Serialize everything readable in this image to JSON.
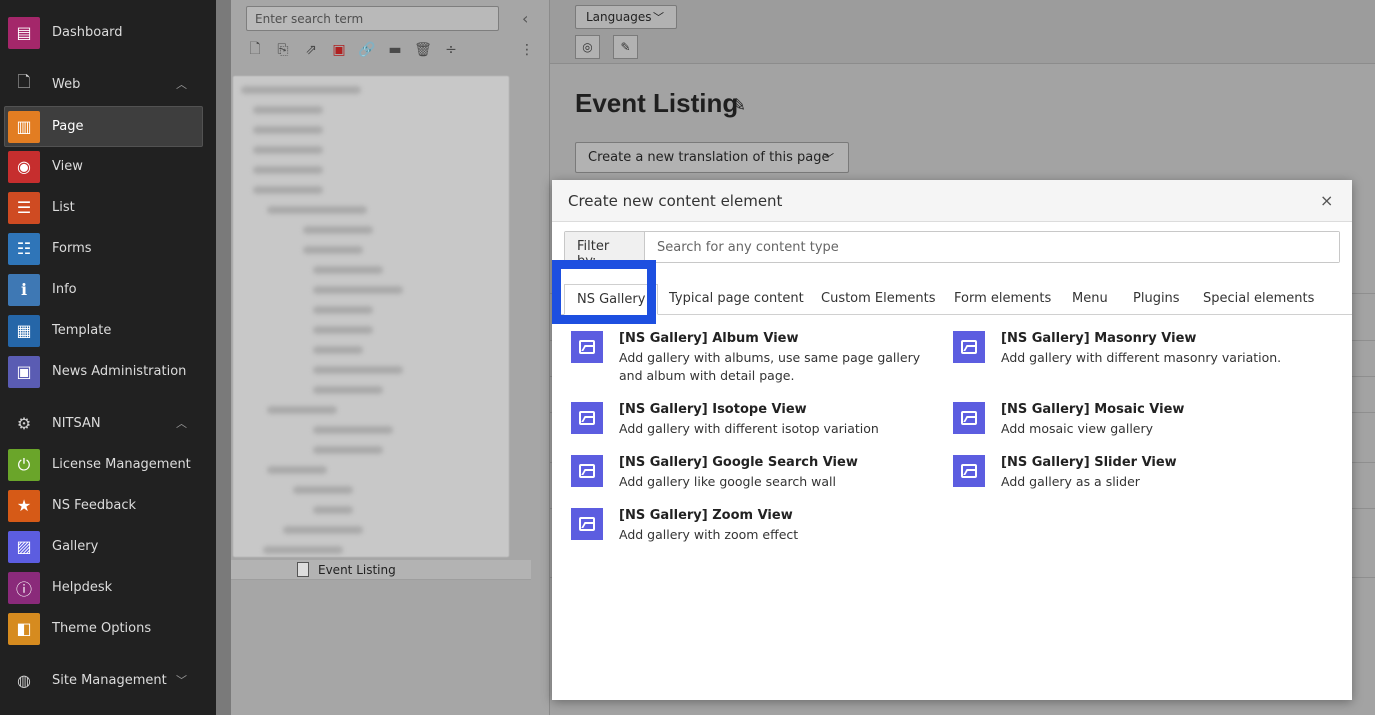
{
  "module_menu": {
    "items": [
      {
        "label": "Dashboard",
        "icon": "dashboard-icon",
        "color": "#a4276a"
      },
      {
        "label": "Web",
        "icon": "web-page-icon",
        "group": true
      },
      {
        "label": "Page",
        "icon": "page-module-icon",
        "color": "#e27d22",
        "active": true
      },
      {
        "label": "View",
        "icon": "eye-icon",
        "color": "#c62e2e"
      },
      {
        "label": "List",
        "icon": "list-icon",
        "color": "#cf4b22"
      },
      {
        "label": "Forms",
        "icon": "forms-icon",
        "color": "#2f75b8"
      },
      {
        "label": "Info",
        "icon": "info-icon",
        "color": "#3e78b4"
      },
      {
        "label": "Template",
        "icon": "template-icon",
        "color": "#2566a8"
      },
      {
        "label": "News Administration",
        "icon": "news-icon",
        "color": "#5a5cb3"
      },
      {
        "label": "NITSAN",
        "icon": "gear-icon",
        "group": true
      },
      {
        "label": "License Management",
        "icon": "power-icon",
        "color": "#6aa52a"
      },
      {
        "label": "NS Feedback",
        "icon": "star-icon",
        "color": "#d65a17"
      },
      {
        "label": "Gallery",
        "icon": "gallery-icon",
        "color": "#5c5de0"
      },
      {
        "label": "Helpdesk",
        "icon": "info-circle-icon",
        "color": "#8a2a7a"
      },
      {
        "label": "Theme Options",
        "icon": "box-icon",
        "color": "#d68b1f"
      },
      {
        "label": "Site Management",
        "icon": "globe-icon",
        "group": true
      }
    ]
  },
  "page_tree": {
    "search_placeholder": "Enter search term",
    "collapse_icon": "‹",
    "selected_page": "Event Listing"
  },
  "doc_header": {
    "languages_label": "Languages",
    "page_title": "Event Listing",
    "translate_label": "Create a new translation of this page"
  },
  "modal": {
    "title": "Create new content element",
    "close": "×",
    "filter_label": "Filter by:",
    "filter_placeholder": "Search for any content type",
    "tabs": [
      "NS Gallery",
      "Typical page content",
      "Custom Elements",
      "Form elements",
      "Menu",
      "Plugins",
      "Special elements"
    ],
    "active_tab": "NS Gallery",
    "elements": [
      {
        "title": "[NS Gallery] Album View",
        "desc": "Add gallery with albums, use same page gallery and album with detail page."
      },
      {
        "title": "[NS Gallery] Masonry View",
        "desc": "Add gallery with different masonry variation."
      },
      {
        "title": "[NS Gallery] Isotope View",
        "desc": "Add gallery with different isotop variation"
      },
      {
        "title": "[NS Gallery] Mosaic View",
        "desc": "Add mosaic view gallery"
      },
      {
        "title": "[NS Gallery] Google Search View",
        "desc": "Add gallery like google search wall"
      },
      {
        "title": "[NS Gallery] Slider View",
        "desc": "Add gallery as a slider"
      },
      {
        "title": "[NS Gallery] Zoom View",
        "desc": "Add gallery with zoom effect"
      }
    ],
    "highlight_color": "#1d4fe0",
    "element_icon_color": "#5c5de0"
  }
}
